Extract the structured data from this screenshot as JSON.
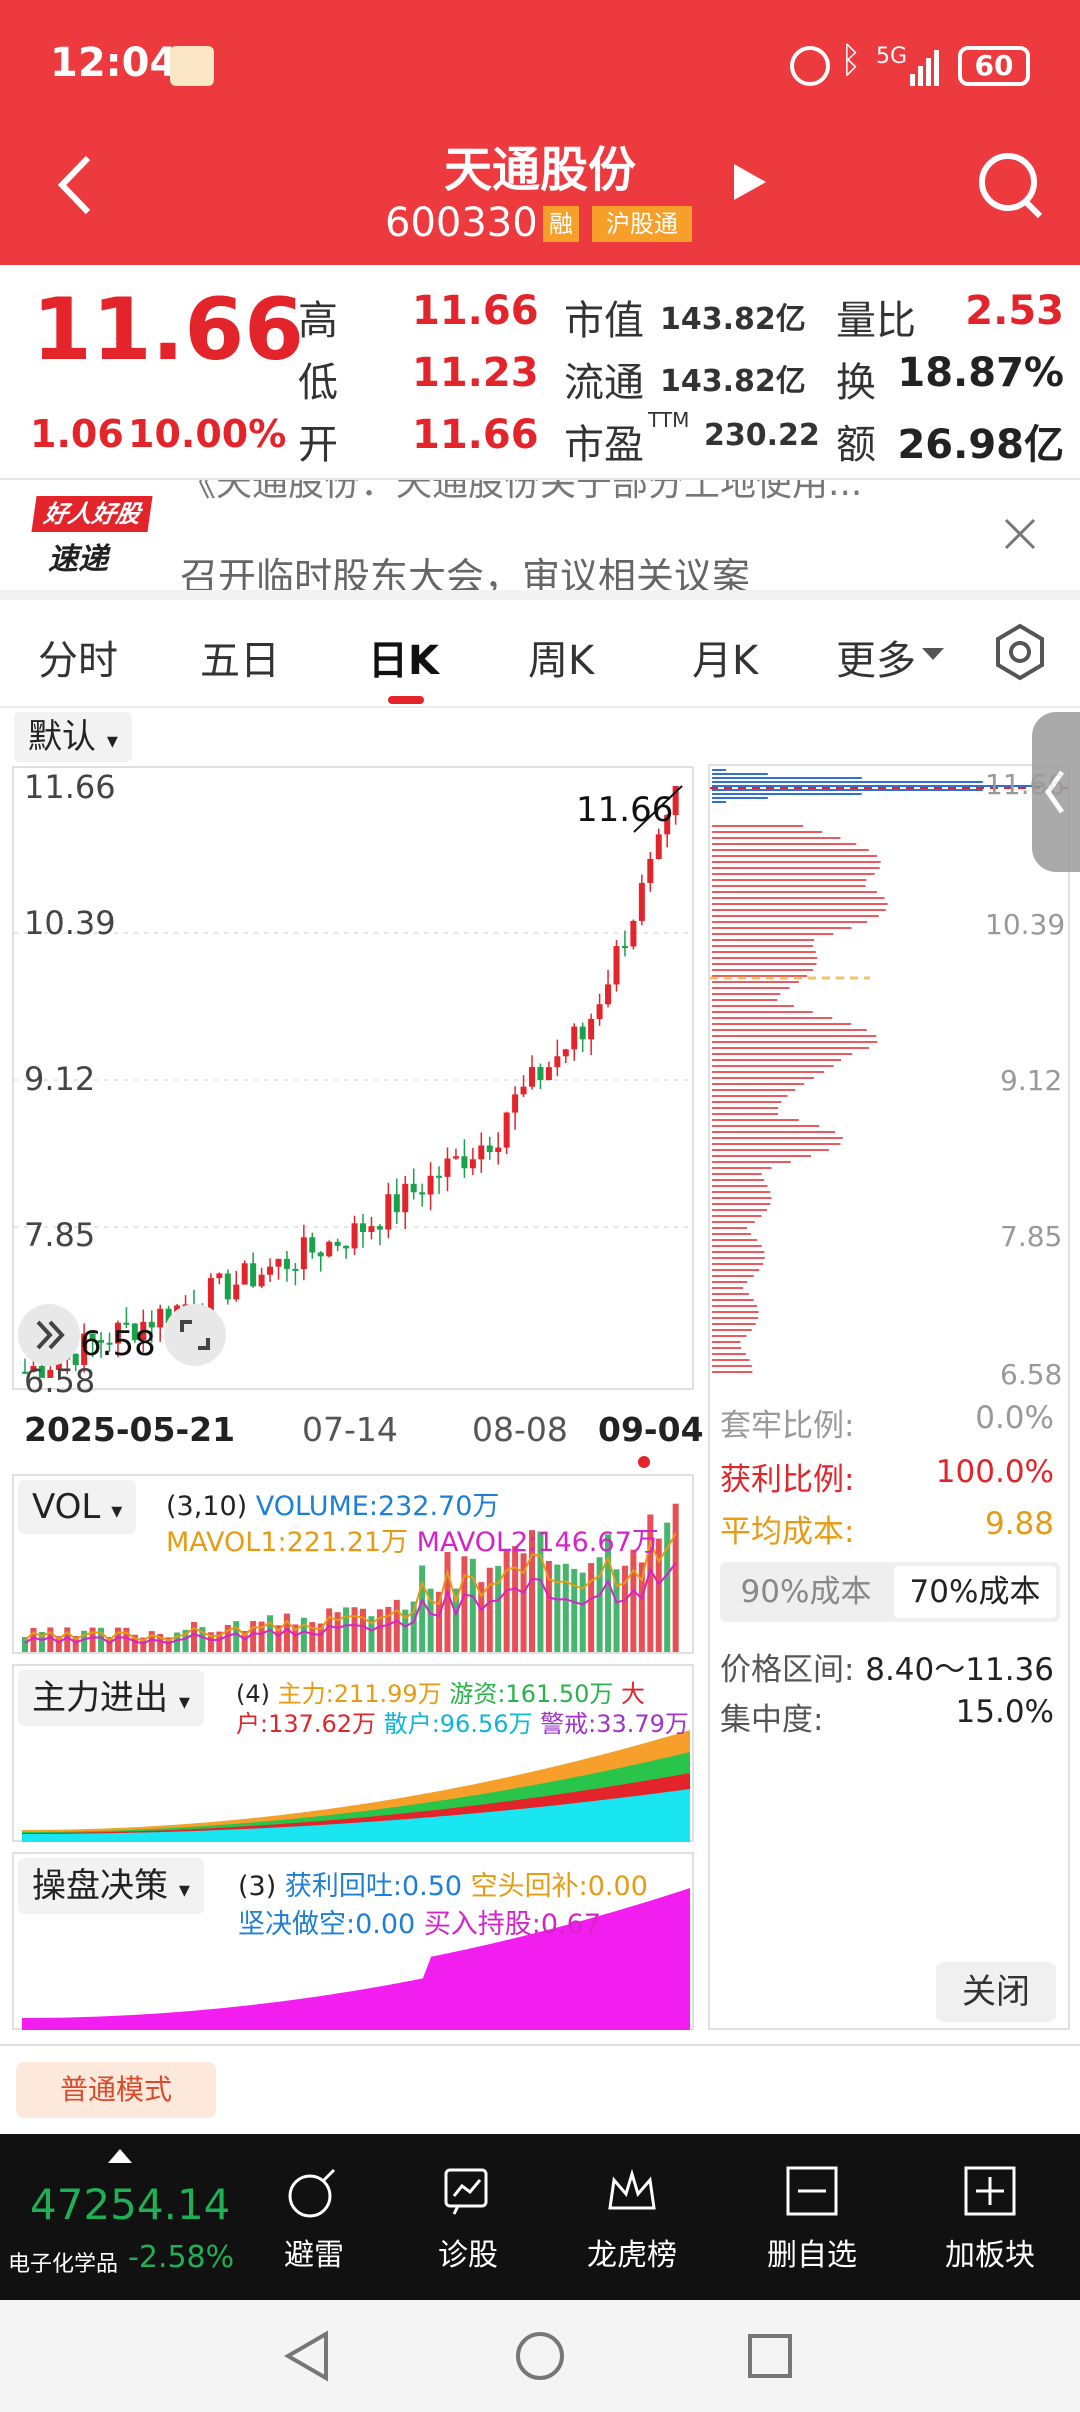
{
  "status_bar": {
    "time": "12:04",
    "network": "5G",
    "battery": "60"
  },
  "header": {
    "title": "天通股份",
    "code": "600330",
    "badge1": "融",
    "badge2": "沪股通"
  },
  "quote": {
    "price": "11.66",
    "change": "1.06",
    "change_pct": "10.00%",
    "high_label": "高",
    "high": "11.66",
    "low_label": "低",
    "low": "11.23",
    "open_label": "开",
    "open": "11.66",
    "mcap_label": "市值",
    "mcap": "143.82亿",
    "float_label": "流通",
    "float": "143.82亿",
    "pe_label": "市盈",
    "pe_sup": "TTM",
    "pe": "230.22",
    "vr_label": "量比",
    "vr": "2.53",
    "turn_label": "换",
    "turn": "18.87%",
    "amt_label": "额",
    "amt": "26.98亿"
  },
  "news": {
    "brand_top": "好人好股",
    "brand_bottom": "速递",
    "line1": "《天通股份：天通股份关于部分土地使用...",
    "line2": "召开临时股东大会，审议相关议案"
  },
  "tabs": [
    "分时",
    "五日",
    "日K",
    "周K",
    "月K",
    "更多"
  ],
  "active_tab": 2,
  "chart": {
    "mode": "默认",
    "y_labels": [
      "11.66",
      "10.39",
      "9.12",
      "7.85",
      "6.58"
    ],
    "last_label": "11.66",
    "low_label": "6.58",
    "x_labels": [
      "2025-05-21",
      "07-14",
      "08-08",
      "09-04"
    ]
  },
  "chip": {
    "rows": [
      {
        "label": "套牢比例:",
        "value": "0.0%"
      },
      {
        "label": "获利比例:",
        "value": "100.0%"
      },
      {
        "label": "平均成本:",
        "value": "9.88"
      }
    ],
    "btn90": "90%成本",
    "btn70": "70%成本",
    "range_label": "价格区间:",
    "range": "8.40～11.36",
    "conc_label": "集中度:",
    "conc": "15.0%",
    "close": "关闭"
  },
  "vol": {
    "title": "VOL",
    "params": "(3,10)",
    "volume": "VOLUME:232.70万",
    "mavol1": "MAVOL1:221.21万",
    "mavol2": "MAVOL2:146.67万"
  },
  "flow": {
    "title": "主力进出",
    "params": "(4)",
    "main": "主力:211.99万",
    "hot": "游资:161.50万",
    "big_a": "大",
    "big_b": "户:137.62万",
    "retail": "散户:96.56万",
    "warn": "警戒:33.79万"
  },
  "ops": {
    "title": "操盘决策",
    "params": "(3)",
    "tp": "获利回吐:0.50",
    "sc": "空头回补:0.00",
    "ss": "坚决做空:0.00",
    "bh": "买入持股:0.67"
  },
  "mode_btn": "普通模式",
  "bottom": {
    "index_value": "47254.14",
    "index_name": "电子化学品",
    "index_change": "-2.58%",
    "items": [
      "避雷",
      "诊股",
      "龙虎榜",
      "删自选",
      "加板块"
    ]
  },
  "colors": {
    "brand_red": "#ec3a3f",
    "up": "#e4242b",
    "down": "#18a24a",
    "panel_bg": "#111111"
  }
}
